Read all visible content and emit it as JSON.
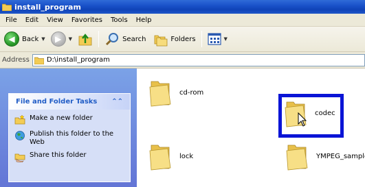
{
  "window": {
    "title": "install_program"
  },
  "menu": [
    "File",
    "Edit",
    "View",
    "Favorites",
    "Tools",
    "Help"
  ],
  "toolbar": {
    "back_label": "Back",
    "search_label": "Search",
    "folders_label": "Folders"
  },
  "address": {
    "label": "Address",
    "value": "D:\\install_program"
  },
  "tasks": {
    "header": "File and Folder Tasks",
    "items": [
      {
        "label": "Make a new folder",
        "icon": "new-folder-icon"
      },
      {
        "label": "Publish this folder to the Web",
        "icon": "web-publish-icon"
      },
      {
        "label": "Share this folder",
        "icon": "share-folder-icon"
      }
    ]
  },
  "files": [
    {
      "name": "cd-rom"
    },
    {
      "name": "codec",
      "selected": true
    },
    {
      "name": "lock"
    },
    {
      "name": "YMPEG_sample"
    }
  ],
  "colors": {
    "selection_box": "#0a14d6",
    "titlebar": "#1a52c9",
    "folder": "#f5d876"
  }
}
